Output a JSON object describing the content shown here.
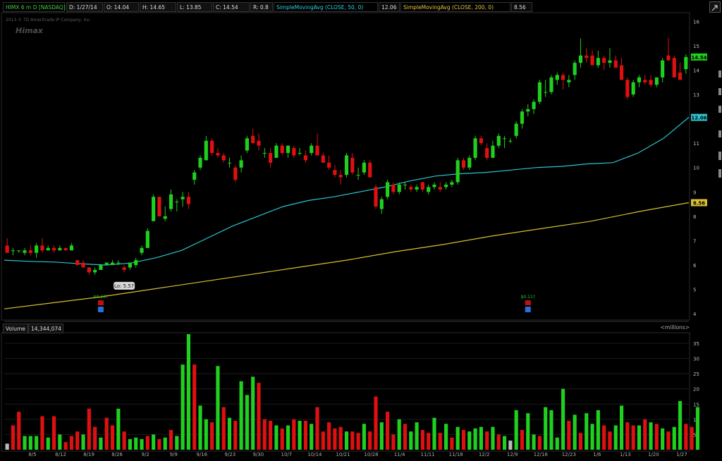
{
  "header": {
    "symbol": "HIMX 6 m D [NASDAQ]",
    "date": "D: 1/27/14",
    "open": "O: 14.04",
    "high": "H: 14.65",
    "low": "L: 13.85",
    "close": "C: 14.54",
    "range": "R: 0.8",
    "sma50_label": "SimpleMovingAvg (CLOSE, 50, 0)",
    "sma50_value": "12.06",
    "sma200_label": "SimpleMovingAvg (CLOSE, 200, 0)",
    "sma200_value": "8.56"
  },
  "watermark": {
    "copyright": "2013 © TD Ameritrade IP Company, Inc.",
    "brand": "Himax"
  },
  "volume_header": {
    "label": "Volume",
    "value": "14,344,074",
    "units": "<millions>"
  },
  "colors": {
    "up": "#1fd01f",
    "down": "#e01010",
    "neutral": "#bbbbbb",
    "sma50": "#2ec4cf",
    "sma200": "#d8c032",
    "background": "#000000",
    "grid": "#262626"
  },
  "chart_data": [
    {
      "type": "candlestick",
      "ylim": [
        3.8,
        16.3
      ],
      "y_ticks": [
        4,
        5,
        6,
        7,
        8,
        9,
        10,
        11,
        12,
        13,
        14,
        15,
        16
      ],
      "x_tick_labels": [
        "8/5",
        "8/12",
        "8/19",
        "8/26",
        "9/2",
        "9/9",
        "9/16",
        "9/23",
        "9/30",
        "10/7",
        "10/14",
        "10/21",
        "10/28",
        "11/4",
        "11/11",
        "11/18",
        "12/2",
        "12/9",
        "12/16",
        "12/23",
        "1/6",
        "1/13",
        "1/20",
        "1/27"
      ],
      "annotations": [
        {
          "text": "Hi: 15.33",
          "x": 150,
          "y": 15.33
        },
        {
          "text": "Lo: 5.57",
          "x": 20,
          "y": 5.57
        }
      ],
      "price_labels": [
        {
          "text": "14.54",
          "y": 14.54,
          "color": "#1fd01f"
        },
        {
          "text": "12.06",
          "y": 12.06,
          "color": "#2ec4cf"
        },
        {
          "text": "8.56",
          "y": 8.56,
          "color": "#d8c032"
        }
      ],
      "event_markers": [
        {
          "text": "$0.11?",
          "x": 16
        },
        {
          "text": "$0.11?",
          "x": 89
        }
      ],
      "candles": [
        [
          6.8,
          7.1,
          6.6,
          6.5
        ],
        [
          6.6,
          6.7,
          6.4,
          6.6
        ],
        [
          6.6,
          6.6,
          6.5,
          6.6
        ],
        [
          6.5,
          6.7,
          6.4,
          6.6
        ],
        [
          6.6,
          6.8,
          6.4,
          6.5
        ],
        [
          6.5,
          6.9,
          6.3,
          6.8
        ],
        [
          6.8,
          7.1,
          6.5,
          6.6
        ],
        [
          6.6,
          6.8,
          6.6,
          6.7
        ],
        [
          6.7,
          6.8,
          6.5,
          6.6
        ],
        [
          6.6,
          6.8,
          6.6,
          6.7
        ],
        [
          6.7,
          6.7,
          6.6,
          6.6
        ],
        [
          6.6,
          6.9,
          6.6,
          6.8
        ],
        [
          6.2,
          6.2,
          6.0,
          6.0
        ],
        [
          6.1,
          6.2,
          5.9,
          5.9
        ],
        [
          5.9,
          5.9,
          5.6,
          5.7
        ],
        [
          5.7,
          5.9,
          5.6,
          5.8
        ],
        [
          5.8,
          6.0,
          5.8,
          6.0
        ],
        [
          6.0,
          6.1,
          6.0,
          6.1
        ],
        [
          6.0,
          6.2,
          6.0,
          6.1
        ],
        [
          6.1,
          6.2,
          6.0,
          6.1
        ],
        [
          5.9,
          6.0,
          5.7,
          5.8
        ],
        [
          5.9,
          6.1,
          5.8,
          6.1
        ],
        [
          6.0,
          6.3,
          5.9,
          6.2
        ],
        [
          6.5,
          6.8,
          6.4,
          6.7
        ],
        [
          6.7,
          7.5,
          6.7,
          7.4
        ],
        [
          7.8,
          8.9,
          7.8,
          8.8
        ],
        [
          8.8,
          8.8,
          8.0,
          8.0
        ],
        [
          7.9,
          8.4,
          7.8,
          8.0
        ],
        [
          8.3,
          9.1,
          8.2,
          8.9
        ],
        [
          8.6,
          8.7,
          8.2,
          8.6
        ],
        [
          8.7,
          9.0,
          8.4,
          8.8
        ],
        [
          8.8,
          9.0,
          8.3,
          8.5
        ],
        [
          9.5,
          9.9,
          9.3,
          9.8
        ],
        [
          10.0,
          10.5,
          9.9,
          10.4
        ],
        [
          10.3,
          11.3,
          10.3,
          11.1
        ],
        [
          11.1,
          11.2,
          10.5,
          10.6
        ],
        [
          10.6,
          10.8,
          10.4,
          10.5
        ],
        [
          10.5,
          10.6,
          10.2,
          10.3
        ],
        [
          10.2,
          10.4,
          10.0,
          10.2
        ],
        [
          10.0,
          10.1,
          9.4,
          9.5
        ],
        [
          10.0,
          10.5,
          9.8,
          10.3
        ],
        [
          10.7,
          11.3,
          10.6,
          11.2
        ],
        [
          11.3,
          11.6,
          11.0,
          11.0
        ],
        [
          11.1,
          11.4,
          10.7,
          10.9
        ],
        [
          10.6,
          10.8,
          10.4,
          10.6
        ],
        [
          10.6,
          10.8,
          10.0,
          10.2
        ],
        [
          10.4,
          11.0,
          10.4,
          10.9
        ],
        [
          10.9,
          11.0,
          10.5,
          10.6
        ],
        [
          10.6,
          10.9,
          10.4,
          10.9
        ],
        [
          10.8,
          10.9,
          10.4,
          10.5
        ],
        [
          10.6,
          10.8,
          10.5,
          10.6
        ],
        [
          10.5,
          10.7,
          10.2,
          10.3
        ],
        [
          10.6,
          11.0,
          10.5,
          10.9
        ],
        [
          10.9,
          11.4,
          10.5,
          10.5
        ],
        [
          10.5,
          10.6,
          10.2,
          10.2
        ],
        [
          10.2,
          10.5,
          9.9,
          10.0
        ],
        [
          9.9,
          10.1,
          9.6,
          9.7
        ],
        [
          9.7,
          9.9,
          9.3,
          9.6
        ],
        [
          9.7,
          10.6,
          9.6,
          10.5
        ],
        [
          10.4,
          10.6,
          9.7,
          9.8
        ],
        [
          9.7,
          10.0,
          9.5,
          9.7
        ],
        [
          9.8,
          10.3,
          9.7,
          10.2
        ],
        [
          10.2,
          10.3,
          9.6,
          9.6
        ],
        [
          9.2,
          9.3,
          8.3,
          8.4
        ],
        [
          8.3,
          8.8,
          8.1,
          8.7
        ],
        [
          8.8,
          9.5,
          8.7,
          9.4
        ],
        [
          9.3,
          9.4,
          8.9,
          9.0
        ],
        [
          9.0,
          9.4,
          8.9,
          9.3
        ],
        [
          9.3,
          9.4,
          9.1,
          9.3
        ],
        [
          9.2,
          9.3,
          9.0,
          9.1
        ],
        [
          9.1,
          9.3,
          9.0,
          9.2
        ],
        [
          9.4,
          9.4,
          9.0,
          9.1
        ],
        [
          9.0,
          9.3,
          8.9,
          9.2
        ],
        [
          9.2,
          9.4,
          9.1,
          9.3
        ],
        [
          9.2,
          9.4,
          9.0,
          9.1
        ],
        [
          9.2,
          9.4,
          9.1,
          9.3
        ],
        [
          9.3,
          9.5,
          9.2,
          9.4
        ],
        [
          9.4,
          10.4,
          9.3,
          10.3
        ],
        [
          10.3,
          10.4,
          9.9,
          10.0
        ],
        [
          10.0,
          10.5,
          9.9,
          10.4
        ],
        [
          10.4,
          11.3,
          10.3,
          11.2
        ],
        [
          11.2,
          11.3,
          10.9,
          11.0
        ],
        [
          10.8,
          11.0,
          10.3,
          10.4
        ],
        [
          10.4,
          11.1,
          10.4,
          10.9
        ],
        [
          10.9,
          11.4,
          10.8,
          11.3
        ],
        [
          11.2,
          11.3,
          10.8,
          11.2
        ],
        [
          11.1,
          11.2,
          11.0,
          11.1
        ],
        [
          11.3,
          11.9,
          11.2,
          11.8
        ],
        [
          11.8,
          12.4,
          11.6,
          12.3
        ],
        [
          12.3,
          12.6,
          12.1,
          12.4
        ],
        [
          12.4,
          12.8,
          12.2,
          12.7
        ],
        [
          12.7,
          13.6,
          12.6,
          13.5
        ],
        [
          13.1,
          13.6,
          12.9,
          13.1
        ],
        [
          13.1,
          13.8,
          13.0,
          13.7
        ],
        [
          13.6,
          13.9,
          13.4,
          13.8
        ],
        [
          13.8,
          13.9,
          13.2,
          13.6
        ],
        [
          13.5,
          13.8,
          13.3,
          13.6
        ],
        [
          13.8,
          14.4,
          13.6,
          14.3
        ],
        [
          14.3,
          15.3,
          14.1,
          14.6
        ],
        [
          14.6,
          14.9,
          14.3,
          14.5
        ],
        [
          14.6,
          14.8,
          14.4,
          14.2
        ],
        [
          14.2,
          14.8,
          14.1,
          14.5
        ],
        [
          14.5,
          14.6,
          14.0,
          14.3
        ],
        [
          14.3,
          14.9,
          14.1,
          14.4
        ],
        [
          14.4,
          14.6,
          14.2,
          14.1
        ],
        [
          14.2,
          14.5,
          13.9,
          13.6
        ],
        [
          13.6,
          13.7,
          12.8,
          12.9
        ],
        [
          13.0,
          13.6,
          12.9,
          13.5
        ],
        [
          13.5,
          13.8,
          13.3,
          13.7
        ],
        [
          13.6,
          13.8,
          13.4,
          13.5
        ],
        [
          13.6,
          13.8,
          13.3,
          13.4
        ],
        [
          13.4,
          13.7,
          13.3,
          13.7
        ],
        [
          13.7,
          14.5,
          13.5,
          14.4
        ],
        [
          14.6,
          15.33,
          14.4,
          14.4
        ],
        [
          14.5,
          14.6,
          13.9,
          13.7
        ],
        [
          13.9,
          14.3,
          13.6,
          13.6
        ],
        [
          14.04,
          14.65,
          13.85,
          14.54
        ]
      ],
      "sma50": [
        6.2,
        6.15,
        6.12,
        6.05,
        6.0,
        6.08,
        6.3,
        6.6,
        7.1,
        7.6,
        8.0,
        8.4,
        8.65,
        8.8,
        9.0,
        9.2,
        9.45,
        9.65,
        9.75,
        9.8,
        9.9,
        10.0,
        10.05,
        10.15,
        10.2,
        10.6,
        11.2,
        12.06
      ],
      "sma200": [
        4.2,
        4.45,
        4.7,
        5.0,
        5.3,
        5.6,
        5.9,
        6.2,
        6.55,
        6.85,
        7.2,
        7.5,
        7.8,
        8.2,
        8.56
      ]
    },
    {
      "type": "bar",
      "title": "Volume",
      "ylabel": "millions",
      "ylim": [
        0,
        38
      ],
      "y_ticks": [
        5,
        10,
        15,
        20,
        25,
        30,
        35
      ],
      "values": [
        2.0,
        8.0,
        12.5,
        4.5,
        4.5,
        4.5,
        11.0,
        4.0,
        11.0,
        5.0,
        2.5,
        4.5,
        6.0,
        5.0,
        13.5,
        7.5,
        4.0,
        10.5,
        8.0,
        13.5,
        6.0,
        3.5,
        4.0,
        3.5,
        4.5,
        5.0,
        3.5,
        4.0,
        6.5,
        4.5,
        28.0,
        38.0,
        28.0,
        14.5,
        10.0,
        9.0,
        27.5,
        14.0,
        10.5,
        9.5,
        22.5,
        18.0,
        24.0,
        22.0,
        10.0,
        9.5,
        8.0,
        7.0,
        8.0,
        10.0,
        9.5,
        9.5,
        8.5,
        14.0,
        6.0,
        9.0,
        7.0,
        7.5,
        6.0,
        6.0,
        5.5,
        8.5,
        6.0,
        17.5,
        9.0,
        12.5,
        5.0,
        10.0,
        8.5,
        6.0,
        9.0,
        6.5,
        5.5,
        10.5,
        5.5,
        8.5,
        4.0,
        7.5,
        6.5,
        6.0,
        7.0,
        7.5,
        6.0,
        7.5,
        5.0,
        4.5,
        3.0,
        13.0,
        6.5,
        12.0,
        5.0,
        4.5,
        14.0,
        13.0,
        4.0,
        20.0,
        9.5,
        11.5,
        5.5,
        12.0,
        8.5,
        13.0,
        8.0,
        6.0,
        8.0,
        14.5,
        9.0,
        8.0,
        8.0,
        10.0,
        9.0,
        8.5,
        7.0,
        6.0,
        7.5,
        16.0,
        8.5,
        7.5,
        14.0
      ],
      "colors": [
        "#bbbbbb",
        "#e01010",
        "#e01010",
        "#1fd01f",
        "#1fd01f",
        "#1fd01f",
        "#e01010",
        "#1fd01f",
        "#e01010",
        "#1fd01f",
        "#e01010",
        "#e01010",
        "#e01010",
        "#1fd01f",
        "#e01010",
        "#e01010",
        "#1fd01f",
        "#e01010",
        "#e01010",
        "#1fd01f",
        "#e01010",
        "#1fd01f",
        "#1fd01f",
        "#1fd01f",
        "#e01010",
        "#1fd01f",
        "#e01010",
        "#1fd01f",
        "#e01010",
        "#1fd01f",
        "#1fd01f",
        "#1fd01f",
        "#e01010",
        "#1fd01f",
        "#1fd01f",
        "#e01010",
        "#1fd01f",
        "#e01010",
        "#1fd01f",
        "#e01010",
        "#1fd01f",
        "#1fd01f",
        "#1fd01f",
        "#e01010",
        "#e01010",
        "#e01010",
        "#1fd01f",
        "#e01010",
        "#1fd01f",
        "#e01010",
        "#1fd01f",
        "#e01010",
        "#1fd01f",
        "#e01010",
        "#e01010",
        "#e01010",
        "#e01010",
        "#e01010",
        "#1fd01f",
        "#e01010",
        "#e01010",
        "#1fd01f",
        "#e01010",
        "#e01010",
        "#1fd01f",
        "#e01010",
        "#e01010",
        "#1fd01f",
        "#e01010",
        "#1fd01f",
        "#1fd01f",
        "#e01010",
        "#e01010",
        "#1fd01f",
        "#e01010",
        "#1fd01f",
        "#e01010",
        "#1fd01f",
        "#e01010",
        "#1fd01f",
        "#1fd01f",
        "#1fd01f",
        "#e01010",
        "#1fd01f",
        "#e01010",
        "#1fd01f",
        "#bbbbbb",
        "#1fd01f",
        "#e01010",
        "#1fd01f",
        "#1fd01f",
        "#e01010",
        "#1fd01f",
        "#1fd01f",
        "#1fd01f",
        "#1fd01f",
        "#e01010",
        "#1fd01f",
        "#e01010",
        "#1fd01f",
        "#1fd01f",
        "#1fd01f",
        "#e01010",
        "#e01010",
        "#1fd01f",
        "#1fd01f",
        "#e01010",
        "#e01010",
        "#1fd01f",
        "#e01010",
        "#1fd01f",
        "#e01010",
        "#1fd01f",
        "#e01010",
        "#1fd01f",
        "#1fd01f",
        "#e01010",
        "#e01010",
        "#1fd01f"
      ]
    }
  ]
}
